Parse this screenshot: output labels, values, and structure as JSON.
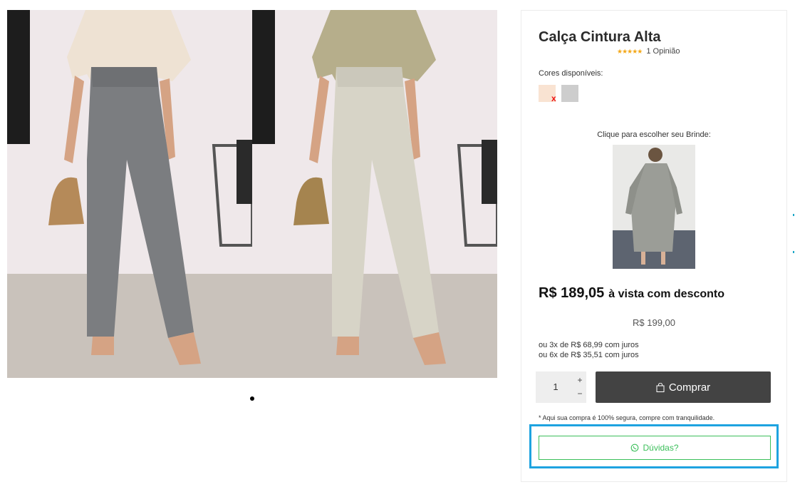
{
  "product": {
    "title": "Calça Cintura Alta",
    "rating_stars": "★★★★★",
    "rating_text": "1 Opinião"
  },
  "colors": {
    "label": "Cores disponíveis:",
    "options": [
      {
        "color": "#f9e3d2",
        "unavailable_mark": "x"
      },
      {
        "color": "#cdcdcd"
      }
    ]
  },
  "gift": {
    "label": "Clique para escolher seu Brinde:"
  },
  "price": {
    "main": "R$ 189,05",
    "suffix": "à vista com desconto",
    "old": "R$ 199,00",
    "installment_1": "ou 3x de R$ 68,99 com juros",
    "installment_2": "ou 6x de R$ 35,51 com juros"
  },
  "purchase": {
    "quantity": "1",
    "plus": "+",
    "minus": "−",
    "buy_label": "Comprar",
    "secure_note": "* Aqui sua compra é 100% segura, compre com tranquilidade.",
    "doubts_label": "Dúvidas?"
  },
  "icons": {
    "buy": "shopping-bag-icon",
    "doubts": "whatsapp-icon"
  },
  "theme": {
    "buy_button_bg": "#434343",
    "doubts_color": "#3bbf5a",
    "highlight_color": "#1ea3e0",
    "star_color": "#f3a81a"
  }
}
